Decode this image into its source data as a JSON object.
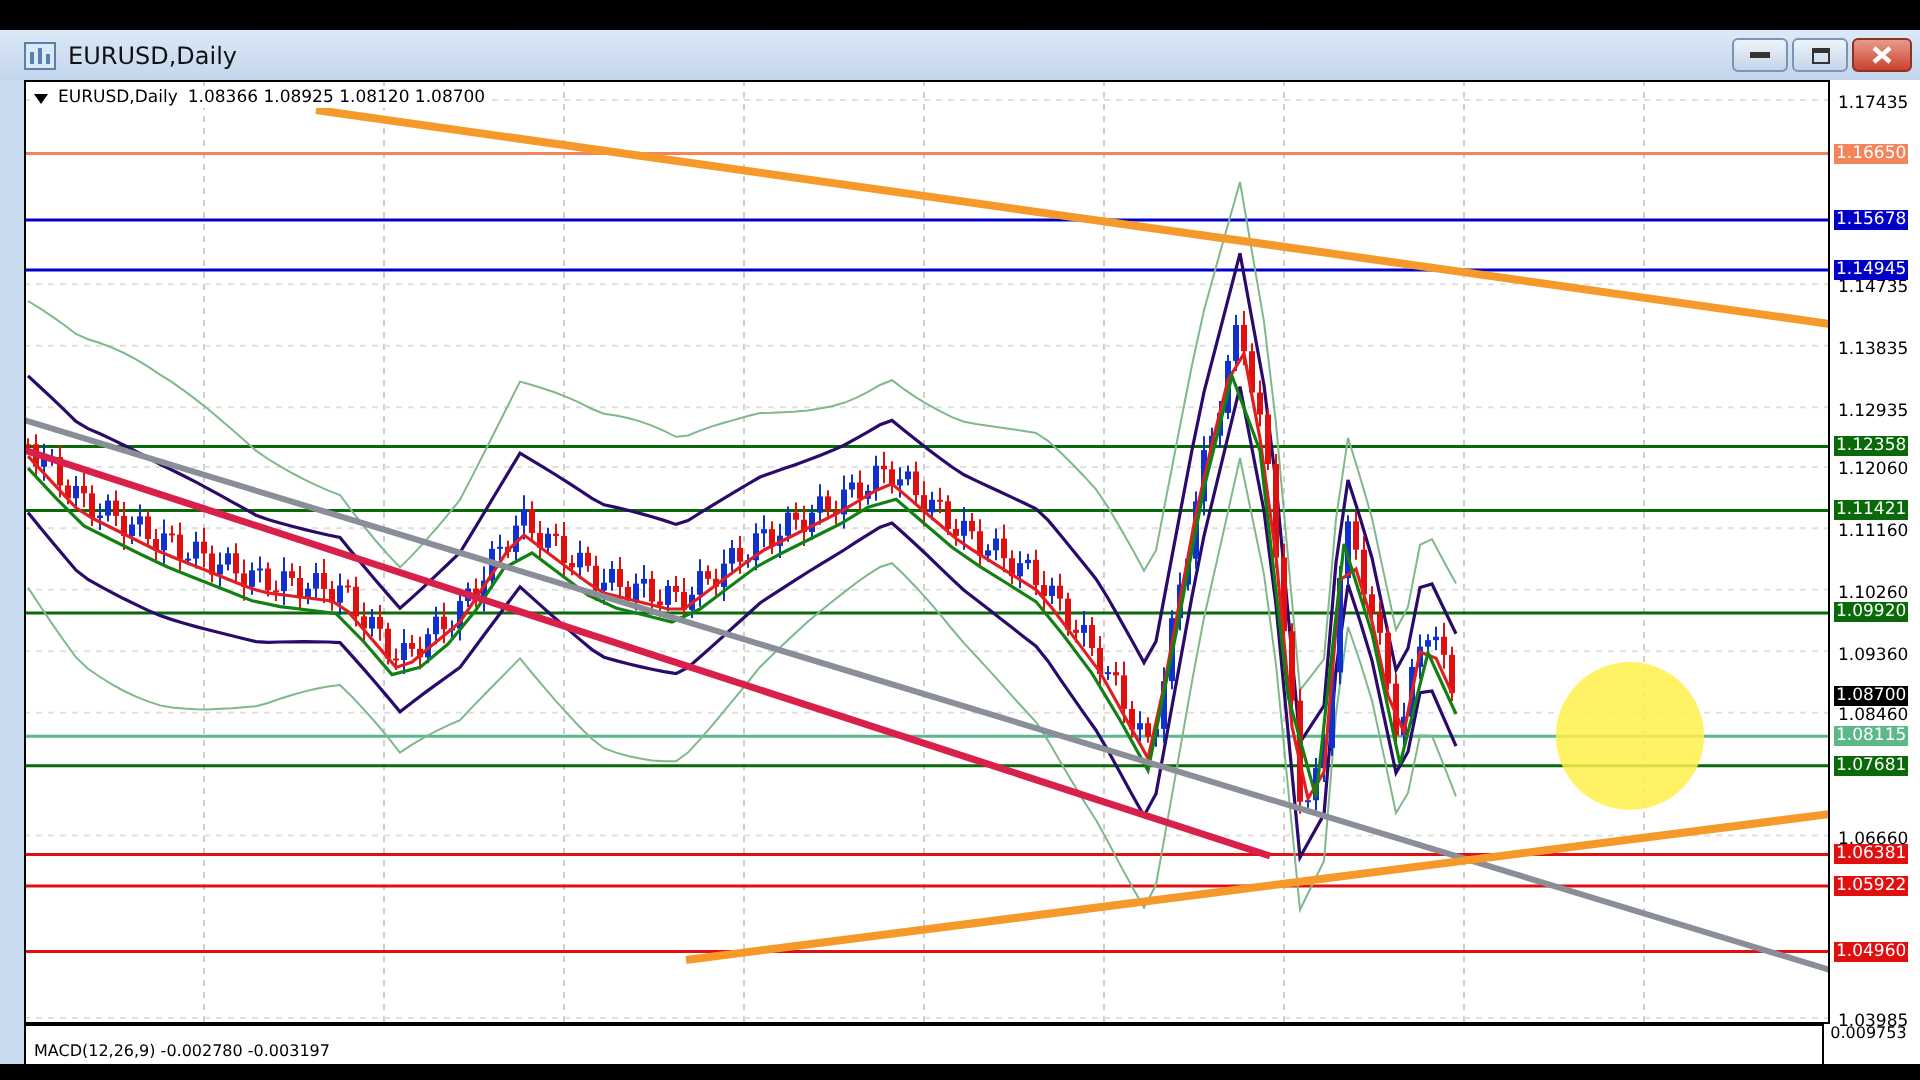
{
  "window": {
    "title": "EURUSD,Daily"
  },
  "chart_header": {
    "symbol": "EURUSD,Daily",
    "ohlc": "1.08366 1.08925 1.08120 1.08700"
  },
  "price_axis": {
    "ticks": [
      "1.17435",
      "1.14735",
      "1.13835",
      "1.12935",
      "1.12060",
      "1.11160",
      "1.10260",
      "1.09360",
      "1.08460",
      "1.06660",
      "1.03985"
    ]
  },
  "levels": [
    {
      "kind": "line",
      "price": "1.16650",
      "color": "#f4845c"
    },
    {
      "kind": "line",
      "price": "1.15678",
      "color": "#0000c8"
    },
    {
      "kind": "line",
      "price": "1.14945",
      "color": "#0000c8"
    },
    {
      "kind": "line",
      "price": "1.12358",
      "color": "#0a6a0a"
    },
    {
      "kind": "line",
      "price": "1.11421",
      "color": "#0a6a0a"
    },
    {
      "kind": "line",
      "price": "1.09920",
      "color": "#0a6a0a"
    },
    {
      "kind": "bid",
      "price": "1.08700",
      "color": "#000000"
    },
    {
      "kind": "line",
      "price": "1.08115",
      "color": "#5cb88a"
    },
    {
      "kind": "line",
      "price": "1.07681",
      "color": "#0a6a0a"
    },
    {
      "kind": "line",
      "price": "1.06381",
      "color": "#e01010"
    },
    {
      "kind": "line",
      "price": "1.05922",
      "color": "#e01010"
    },
    {
      "kind": "line",
      "price": "1.04960",
      "color": "#e01010"
    }
  ],
  "macd": {
    "label": "MACD(12,26,9) -0.002780 -0.003197",
    "scale": "0.009753"
  }
}
